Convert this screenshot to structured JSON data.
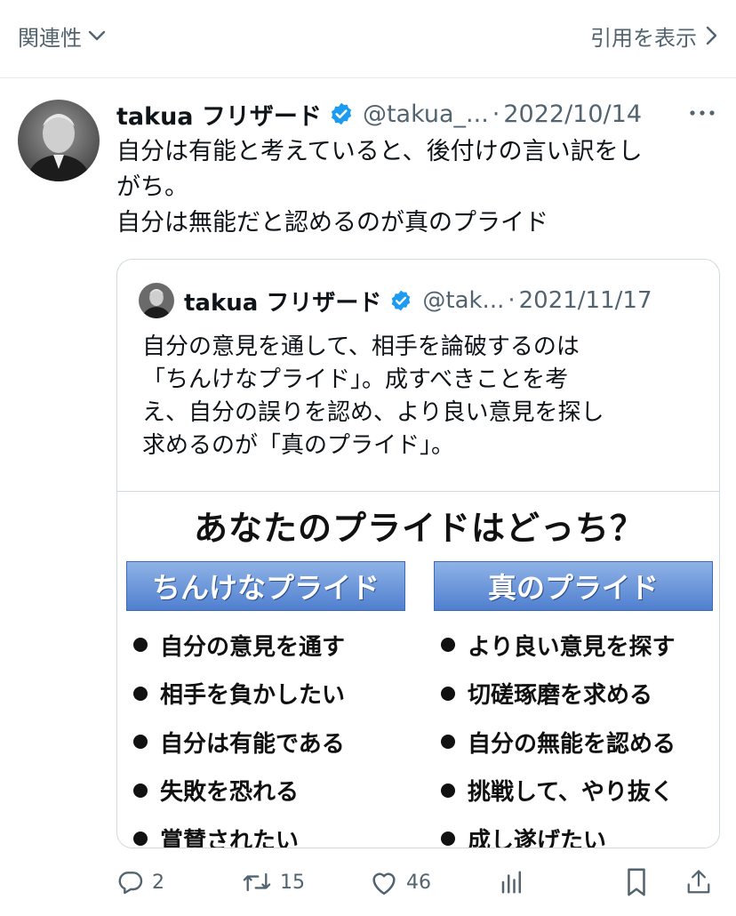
{
  "topbar": {
    "sort_label": "関連性",
    "quotes_label": "引用を表示"
  },
  "tweet": {
    "author_name": "takua フリザード",
    "handle": "@takua_...",
    "separator": "·",
    "date": "2022/10/14",
    "text_lines": [
      "自分は有能と考えていると、後付けの言い訳をし",
      "がち。",
      "自分は無能だと認めるのが真のプライド"
    ],
    "icons": {
      "verified": "verified-badge-icon",
      "more": "more-icon"
    }
  },
  "quote": {
    "author_name": "takua フリザード",
    "handle": "@tak...",
    "separator": "·",
    "date": "2021/11/17",
    "text_lines": [
      "自分の意見を通して、相手を論破するのは",
      "「ちんけなプライド」。成すべきことを考",
      "え、自分の誤りを認め、より良い意見を探し",
      "求めるのが「真のプライド」。"
    ],
    "image": {
      "title": "あなたのプライドはどっち？",
      "left_heading": "ちんけなプライド",
      "right_heading": "真のプライド",
      "left_items": [
        "自分の意見を通す",
        "相手を負かしたい",
        "自分は有能である",
        "失敗を恐れる",
        "賞賛されたい"
      ],
      "right_items": [
        "より良い意見を探す",
        "切磋琢磨を求める",
        "自分の無能を認める",
        "挑戦して、やり抜く",
        "成し遂げたい"
      ],
      "heading_colors": [
        "#8fb3e6",
        "#4f7fcf"
      ]
    }
  },
  "actions": {
    "reply_count": "2",
    "retweet_count": "15",
    "like_count": "46",
    "icons": [
      "reply-icon",
      "retweet-icon",
      "like-icon",
      "views-icon",
      "bookmark-icon",
      "share-icon"
    ]
  },
  "colors": {
    "secondary_text": "#536471",
    "verified_blue": "#1d9bf0",
    "border": "#cfd9de"
  }
}
